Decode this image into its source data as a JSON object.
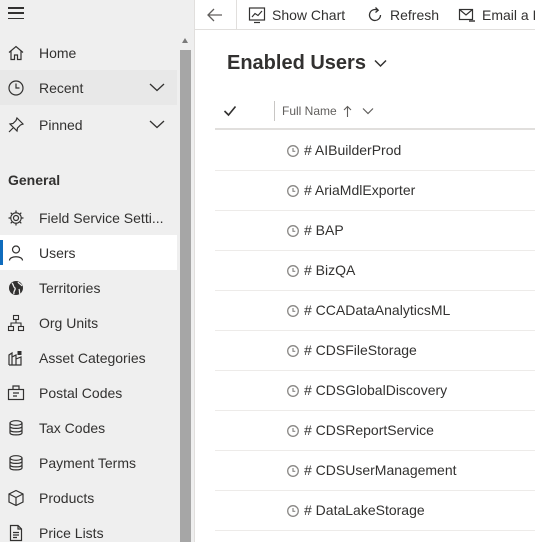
{
  "sidebar": {
    "top_items": [
      {
        "label": "Home",
        "icon": "home-icon"
      },
      {
        "label": "Recent",
        "icon": "clock-icon"
      },
      {
        "label": "Pinned",
        "icon": "pin-icon"
      }
    ],
    "group_title": "General",
    "items": [
      {
        "label": "Field Service Setti...",
        "icon": "gear-icon"
      },
      {
        "label": "Users",
        "icon": "person-icon"
      },
      {
        "label": "Territories",
        "icon": "globe-icon"
      },
      {
        "label": "Org Units",
        "icon": "org-chart-icon"
      },
      {
        "label": "Asset Categories",
        "icon": "asset-icon"
      },
      {
        "label": "Postal Codes",
        "icon": "postal-icon"
      },
      {
        "label": "Tax Codes",
        "icon": "database-icon"
      },
      {
        "label": "Payment Terms",
        "icon": "database-icon"
      },
      {
        "label": "Products",
        "icon": "box-icon"
      },
      {
        "label": "Price Lists",
        "icon": "document-icon"
      }
    ],
    "selected": "Users"
  },
  "commandbar": {
    "show_chart": "Show Chart",
    "refresh": "Refresh",
    "email_link": "Email a L"
  },
  "view": {
    "title": "Enabled Users"
  },
  "grid": {
    "column_header": "Full Name",
    "sort": "ascending",
    "rows": [
      "# AIBuilderProd",
      "# AriaMdlExporter",
      "# BAP",
      "# BizQA",
      "# CCADataAnalyticsML",
      "# CDSFileStorage",
      "# CDSGlobalDiscovery",
      "# CDSReportService",
      "# CDSUserManagement",
      "# DataLakeStorage"
    ]
  },
  "colors": {
    "accent": "#0f6cbd",
    "sidebar_bg": "#efefef",
    "text": "#323130"
  }
}
